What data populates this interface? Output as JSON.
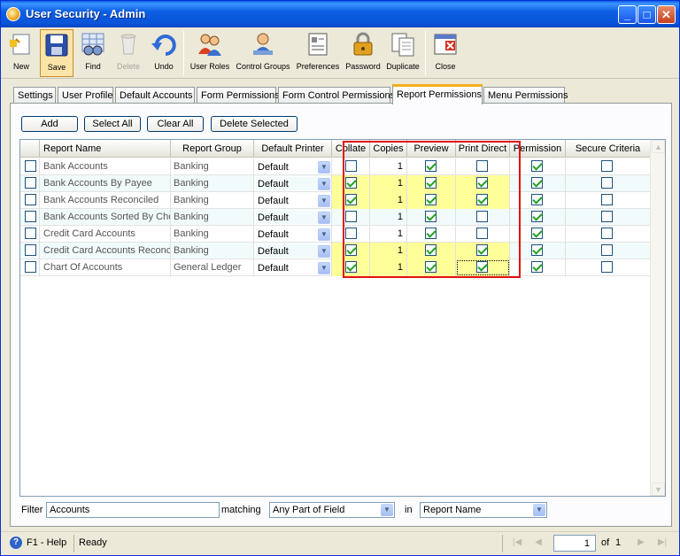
{
  "window": {
    "title": "User Security - Admin",
    "controls": [
      "minimize",
      "maximize",
      "close"
    ]
  },
  "toolbar": {
    "buttons": [
      {
        "label": "New",
        "icon": "new-icon",
        "state": "normal"
      },
      {
        "label": "Save",
        "icon": "save-icon",
        "state": "active"
      },
      {
        "label": "Find",
        "icon": "find-icon",
        "state": "normal"
      },
      {
        "label": "Delete",
        "icon": "delete-icon",
        "state": "disabled"
      },
      {
        "label": "Undo",
        "icon": "undo-icon",
        "state": "normal"
      },
      {
        "label": "User Roles",
        "icon": "user-roles-icon",
        "state": "normal"
      },
      {
        "label": "Control Groups",
        "icon": "control-groups-icon",
        "state": "normal"
      },
      {
        "label": "Preferences",
        "icon": "preferences-icon",
        "state": "normal"
      },
      {
        "label": "Password",
        "icon": "password-icon",
        "state": "normal"
      },
      {
        "label": "Duplicate",
        "icon": "duplicate-icon",
        "state": "normal"
      },
      {
        "label": "Close",
        "icon": "close-icon",
        "state": "normal"
      }
    ]
  },
  "tabs": [
    {
      "label": "Settings",
      "active": false
    },
    {
      "label": "User Profile",
      "active": false
    },
    {
      "label": "Default Accounts",
      "active": false
    },
    {
      "label": "Form Permissions",
      "active": false
    },
    {
      "label": "Form Control Permissions",
      "active": false
    },
    {
      "label": "Report Permissions",
      "active": true
    },
    {
      "label": "Menu Permissions",
      "active": false
    }
  ],
  "actions": {
    "add": "Add",
    "select_all": "Select All",
    "clear_all": "Clear All",
    "delete_selected": "Delete Selected"
  },
  "grid": {
    "columns": {
      "report_name": "Report Name",
      "report_group": "Report Group",
      "default_printer": "Default Printer",
      "collate": "Collate",
      "copies": "Copies",
      "preview": "Preview",
      "print_direct": "Print Direct",
      "permission": "Permission",
      "secure_criteria": "Secure Criteria"
    },
    "rows": [
      {
        "name": "Bank Accounts",
        "group": "Banking",
        "printer": "Default",
        "collate": false,
        "copies": "1",
        "preview": true,
        "print_direct": false,
        "permission": true,
        "secure": false,
        "highlight": false
      },
      {
        "name": "Bank Accounts By Payee",
        "group": "Banking",
        "printer": "Default",
        "collate": true,
        "copies": "1",
        "preview": true,
        "print_direct": true,
        "permission": true,
        "secure": false,
        "highlight": true
      },
      {
        "name": "Bank Accounts Reconciled",
        "group": "Banking",
        "printer": "Default",
        "collate": true,
        "copies": "1",
        "preview": true,
        "print_direct": true,
        "permission": true,
        "secure": false,
        "highlight": true
      },
      {
        "name": "Bank Accounts Sorted By Che",
        "group": "Banking",
        "printer": "Default",
        "collate": false,
        "copies": "1",
        "preview": true,
        "print_direct": false,
        "permission": true,
        "secure": false,
        "highlight": false
      },
      {
        "name": "Credit Card Accounts",
        "group": "Banking",
        "printer": "Default",
        "collate": false,
        "copies": "1",
        "preview": true,
        "print_direct": false,
        "permission": true,
        "secure": false,
        "highlight": false
      },
      {
        "name": "Credit Card Accounts Reconci",
        "group": "Banking",
        "printer": "Default",
        "collate": true,
        "copies": "1",
        "preview": true,
        "print_direct": true,
        "permission": true,
        "secure": false,
        "highlight": true
      },
      {
        "name": "Chart Of Accounts",
        "group": "General Ledger",
        "printer": "Default",
        "collate": true,
        "copies": "1",
        "preview": true,
        "print_direct": true,
        "permission": true,
        "secure": false,
        "highlight": true
      }
    ]
  },
  "filter": {
    "label": "Filter",
    "value": "Accounts",
    "matching_label": "matching",
    "matching_value": "Any Part of Field",
    "in_label": "in",
    "field_value": "Report Name"
  },
  "status": {
    "help": "F1 - Help",
    "state": "Ready",
    "page": "1",
    "of_label": "of",
    "total_pages": "1"
  },
  "colors": {
    "highlight": "#ffff99",
    "selection_box": "#e01010",
    "titlebar": "#0a54d8"
  }
}
